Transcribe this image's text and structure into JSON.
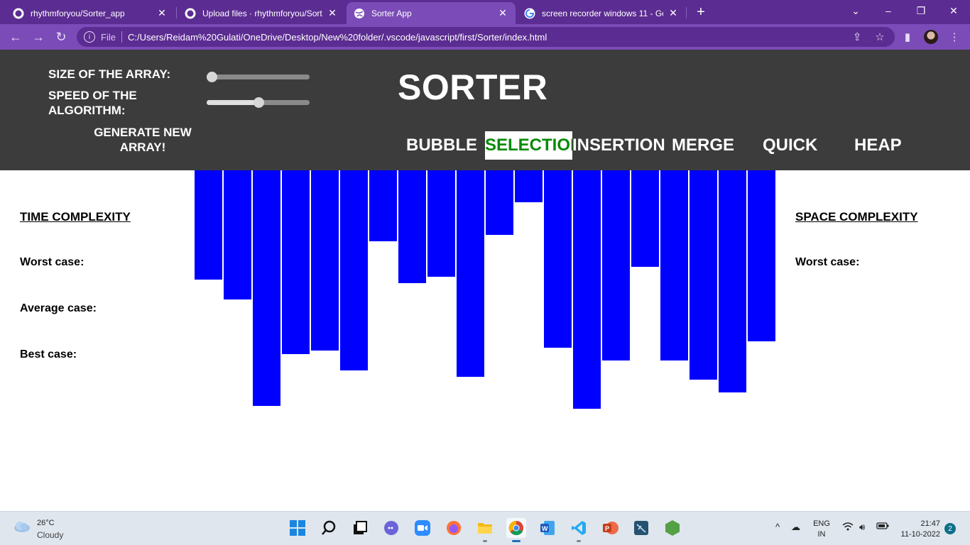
{
  "browser": {
    "tabs": [
      {
        "title": "rhythmforyou/Sorter_app",
        "icon": "github-icon"
      },
      {
        "title": "Upload files · rhythmforyou/Sorter",
        "icon": "github-icon"
      },
      {
        "title": "Sorter App",
        "icon": "globe-icon",
        "active": true
      },
      {
        "title": "screen recorder windows 11 - Go",
        "icon": "google-icon"
      }
    ],
    "url_prefix": "File",
    "url": "C:/Users/Reidam%20Gulati/OneDrive/Desktop/New%20folder/.vscode/javascript/first/Sorter/index.html"
  },
  "header": {
    "size_label": "SIZE OF THE ARRAY:",
    "speed_label": "SPEED OF THE ALGORITHM:",
    "size_value": 0.05,
    "speed_value": 0.5,
    "generate_label": "GENERATE NEW ARRAY!",
    "title": "SORTER",
    "algorithms": {
      "bubble": "BUBBLE",
      "selection": "SELECTION",
      "insertion": "INSERTION",
      "merge": "MERGE",
      "quick": "QUICK",
      "heap": "HEAP"
    },
    "selected_algorithm": "selection",
    "selected_color": "#0a8a0a"
  },
  "time_complexity": {
    "heading": "TIME COMPLEXITY",
    "worst": "Worst case:",
    "average": "Average case:",
    "best": "Best case:"
  },
  "space_complexity": {
    "heading": "SPACE COMPLEXITY",
    "worst": "Worst case:"
  },
  "array": {
    "bar_color": "#0000ff",
    "values": [
      154,
      182,
      332,
      259,
      254,
      282,
      100,
      159,
      150,
      291,
      91,
      45,
      250,
      336,
      268,
      136,
      268,
      295,
      313,
      241
    ]
  },
  "taskbar": {
    "temperature": "26°C",
    "condition": "Cloudy",
    "lang_line1": "ENG",
    "lang_line2": "IN",
    "time": "21:47",
    "date": "11-10-2022",
    "notifications": "2"
  }
}
